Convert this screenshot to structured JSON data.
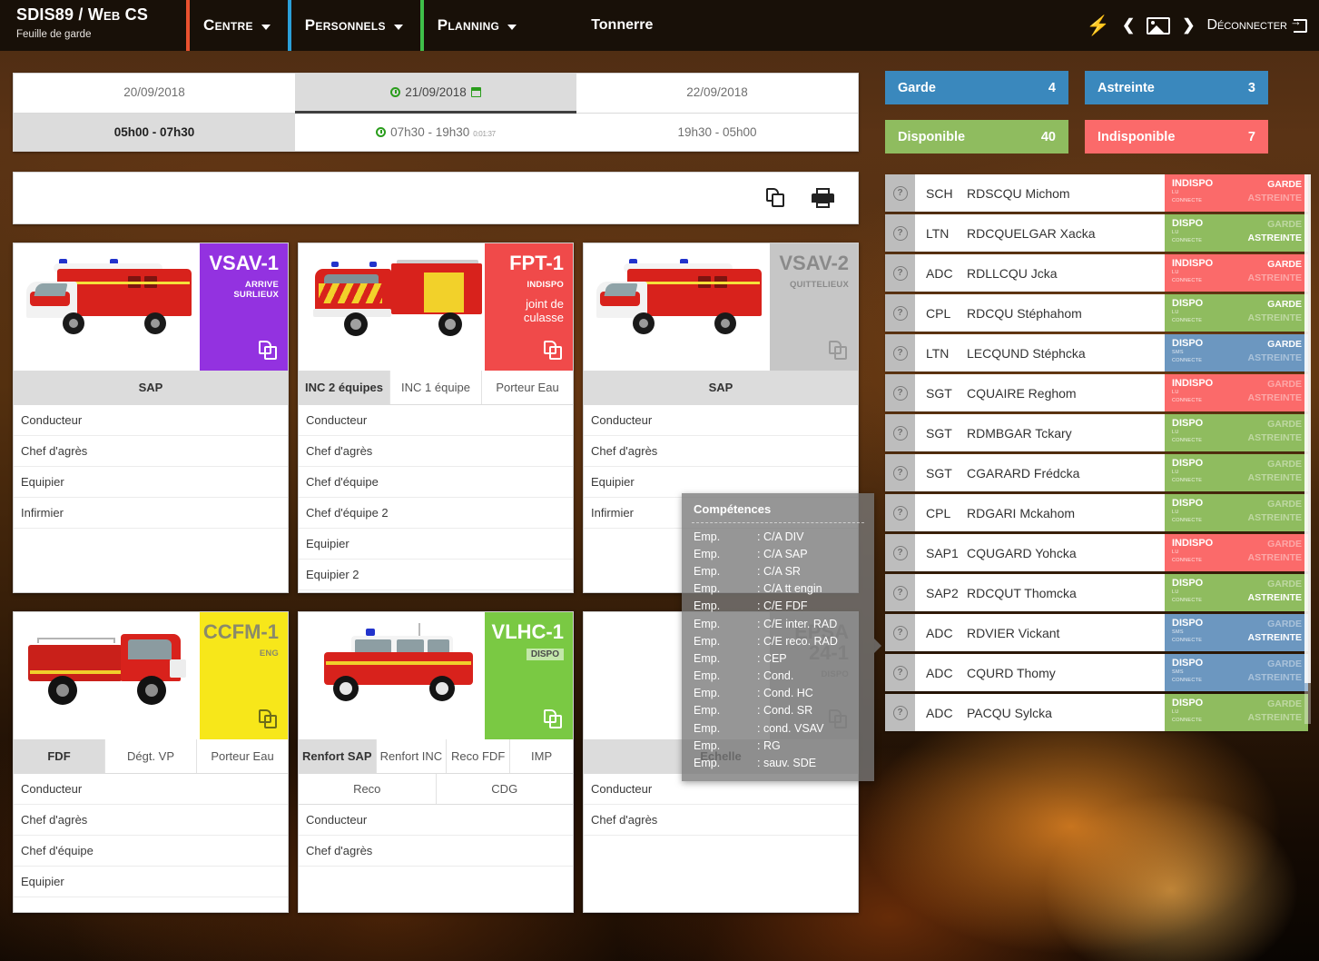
{
  "header": {
    "brand_title": "SDIS89 / Web CS",
    "brand_sub": "Feuille de garde",
    "nav": [
      {
        "label": "Centre",
        "accent": "#e8512f"
      },
      {
        "label": "Personnels",
        "accent": "#2b9fd8"
      },
      {
        "label": "Planning",
        "accent": "#3fbf4a"
      }
    ],
    "centre_name": "Tonnerre",
    "bolt_icon": "lightning-icon",
    "prev_icon": "chevron-left-icon",
    "image_icon": "image-icon",
    "next_icon": "chevron-right-icon",
    "logout_label": "Déconnecter",
    "logout_icon": "logout-icon"
  },
  "dates": {
    "days": [
      {
        "label": "20/09/2018",
        "active": false,
        "has_clock": false,
        "has_cal": false
      },
      {
        "label": "21/09/2018",
        "active": true,
        "has_clock": true,
        "has_cal": true
      },
      {
        "label": "22/09/2018",
        "active": false,
        "has_clock": false,
        "has_cal": false
      }
    ],
    "slots": [
      {
        "label": "05h00 - 07h30",
        "active": true,
        "has_clock": false,
        "timer": ""
      },
      {
        "label": "07h30 - 19h30",
        "active": false,
        "has_clock": true,
        "timer": "0:01:37"
      },
      {
        "label": "19h30 - 05h00",
        "active": false,
        "has_clock": false,
        "timer": ""
      }
    ]
  },
  "toolbar": {
    "copy_icon": "copy-icon",
    "print_icon": "print-icon"
  },
  "vehicles": [
    {
      "name": "VSAV-1",
      "status": "ARRIVE SURLIEUX",
      "note": "",
      "chip": "",
      "badge_bg": "#9332e0",
      "badge_fg": "#ffffff",
      "art": "van",
      "copy_style": "w",
      "tabs": [
        {
          "label": "SAP",
          "sel": true
        }
      ],
      "subtabs": [],
      "roles": [
        "Conducteur",
        "Chef d'agrès",
        "Equipier",
        "Infirmier"
      ]
    },
    {
      "name": "FPT-1",
      "status": "INDISPO",
      "note": "joint de culasse",
      "chip": "",
      "badge_bg": "#f04a4a",
      "badge_fg": "#ffffff",
      "art": "fpt",
      "copy_style": "w",
      "tabs": [
        {
          "label": "INC 2 équipes",
          "sel": true
        },
        {
          "label": "INC 1 équipe",
          "sel": false
        },
        {
          "label": "Porteur Eau",
          "sel": false
        }
      ],
      "subtabs": [],
      "roles": [
        "Conducteur",
        "Chef d'agrès",
        "Chef d'équipe",
        "Chef d'équipe 2",
        "Equipier",
        "Equipier 2"
      ]
    },
    {
      "name": "VSAV-2",
      "status": "QUITTELIEUX",
      "note": "",
      "chip": "",
      "badge_bg": "#c6c6c6",
      "badge_fg": "#8a8a8a",
      "art": "van",
      "copy_style": "g",
      "tabs": [
        {
          "label": "SAP",
          "sel": true
        }
      ],
      "subtabs": [],
      "roles": [
        "Conducteur",
        "Chef d'agrès",
        "Equipier",
        "Infirmier"
      ]
    },
    {
      "name": "CCFM-1",
      "status": "ENG",
      "note": "",
      "chip": "",
      "badge_bg": "#f7e71a",
      "badge_fg": "#8a8a6a",
      "art": "ccfm",
      "copy_style": "dk",
      "tabs": [
        {
          "label": "FDF",
          "sel": true
        },
        {
          "label": "Dégt. VP",
          "sel": false
        },
        {
          "label": "Porteur Eau",
          "sel": false
        }
      ],
      "subtabs": [],
      "roles": [
        "Conducteur",
        "Chef d'agrès",
        "Chef d'équipe",
        "Equipier"
      ]
    },
    {
      "name": "VLHC-1",
      "status": "",
      "note": "",
      "chip": "DISPO",
      "badge_bg": "#7ac943",
      "badge_fg": "#ffffff",
      "art": "vlhc",
      "copy_style": "w",
      "tabs": [
        {
          "label": "Renfort SAP",
          "sel": true
        },
        {
          "label": "Renfort INC",
          "sel": false
        },
        {
          "label": "Reco FDF",
          "sel": false
        },
        {
          "label": "IMP",
          "sel": false
        }
      ],
      "subtabs": [
        {
          "label": "Reco",
          "sel": false
        },
        {
          "label": "CDG",
          "sel": false
        }
      ],
      "roles": [
        "Conducteur",
        "Chef d'agrès"
      ]
    },
    {
      "name": "EPSA 24-1",
      "status": "DISPO",
      "note": "",
      "chip": "",
      "badge_bg": "#c6c6c6",
      "badge_fg": "#9c9c9c",
      "art": "none",
      "copy_style": "g",
      "tabs": [
        {
          "label": "Echelle",
          "sel": true
        }
      ],
      "subtabs": [],
      "roles": [
        "Conducteur",
        "Chef d'agrès"
      ]
    }
  ],
  "tooltip": {
    "title": "Compétences",
    "rows": [
      {
        "k": "Emp.",
        "v": ": C/A DIV"
      },
      {
        "k": "Emp.",
        "v": ": C/A SAP"
      },
      {
        "k": "Emp.",
        "v": ": C/A SR"
      },
      {
        "k": "Emp.",
        "v": ": C/A tt engin"
      },
      {
        "k": "Emp.",
        "v": ": C/E FDF"
      },
      {
        "k": "Emp.",
        "v": ": C/E inter. RAD"
      },
      {
        "k": "Emp.",
        "v": ": C/E reco. RAD"
      },
      {
        "k": "Emp.",
        "v": ": CEP"
      },
      {
        "k": "Emp.",
        "v": ": Cond."
      },
      {
        "k": "Emp.",
        "v": ": Cond. HC"
      },
      {
        "k": "Emp.",
        "v": ": Cond. SR"
      },
      {
        "k": "Emp.",
        "v": ": cond. VSAV"
      },
      {
        "k": "Emp.",
        "v": ": RG"
      },
      {
        "k": "Emp.",
        "v": ": sauv. SDE"
      }
    ]
  },
  "stats": [
    {
      "label": "Garde",
      "value": "4",
      "bg": "#3a88bd"
    },
    {
      "label": "Astreinte",
      "value": "3",
      "bg": "#3a88bd"
    },
    {
      "label": "Disponible",
      "value": "40",
      "bg": "#8fbc5f"
    },
    {
      "label": "Indisponible",
      "value": "7",
      "bg": "#fb6a6a"
    }
  ],
  "people_labels": {
    "garde": "GARDE",
    "astreinte": "ASTREINTE",
    "connecte": "CONNECTE"
  },
  "people": [
    {
      "rank": "SCH",
      "name": "RDSCQU Michom",
      "state": "INDISPO",
      "bg": "#fb6a6a",
      "chan": "LU",
      "garde": true,
      "astreinte": false
    },
    {
      "rank": "LTN",
      "name": "RDCQUELGAR Xacka",
      "state": "DISPO",
      "bg": "#8fbc5f",
      "chan": "LU",
      "garde": false,
      "astreinte": true
    },
    {
      "rank": "ADC",
      "name": "RDLLCQU Jcka",
      "state": "INDISPO",
      "bg": "#fb6a6a",
      "chan": "LU",
      "garde": true,
      "astreinte": false
    },
    {
      "rank": "CPL",
      "name": "RDCQU Stéphahom",
      "state": "DISPO",
      "bg": "#8fbc5f",
      "chan": "LU",
      "garde": true,
      "astreinte": false
    },
    {
      "rank": "LTN",
      "name": "LECQUND Stéphcka",
      "state": "DISPO",
      "bg": "#6c97c0",
      "chan": "SMS",
      "garde": true,
      "astreinte": false
    },
    {
      "rank": "SGT",
      "name": "CQUAIRE Reghom",
      "state": "INDISPO",
      "bg": "#fb6a6a",
      "chan": "LU",
      "garde": false,
      "astreinte": false
    },
    {
      "rank": "SGT",
      "name": "RDMBGAR Tckary",
      "state": "DISPO",
      "bg": "#8fbc5f",
      "chan": "LU",
      "garde": false,
      "astreinte": false
    },
    {
      "rank": "SGT",
      "name": "CGARARD Frédcka",
      "state": "DISPO",
      "bg": "#8fbc5f",
      "chan": "LU",
      "garde": false,
      "astreinte": false
    },
    {
      "rank": "CPL",
      "name": "RDGARI Mckahom",
      "state": "DISPO",
      "bg": "#8fbc5f",
      "chan": "LU",
      "garde": false,
      "astreinte": false
    },
    {
      "rank": "SAP1",
      "name": "CQUGARD Yohcka",
      "state": "INDISPO",
      "bg": "#fb6a6a",
      "chan": "LU",
      "garde": false,
      "astreinte": false
    },
    {
      "rank": "SAP2",
      "name": "RDCQUT Thomcka",
      "state": "DISPO",
      "bg": "#8fbc5f",
      "chan": "LU",
      "garde": false,
      "astreinte": true
    },
    {
      "rank": "ADC",
      "name": "RDVIER Vickant",
      "state": "DISPO",
      "bg": "#6c97c0",
      "chan": "SMS",
      "garde": false,
      "astreinte": true
    },
    {
      "rank": "ADC",
      "name": "CQURD Thomy",
      "state": "DISPO",
      "bg": "#6c97c0",
      "chan": "SMS",
      "garde": false,
      "astreinte": false
    },
    {
      "rank": "ADC",
      "name": "PACQU Sylcka",
      "state": "DISPO",
      "bg": "#8fbc5f",
      "chan": "LU",
      "garde": false,
      "astreinte": false
    }
  ]
}
